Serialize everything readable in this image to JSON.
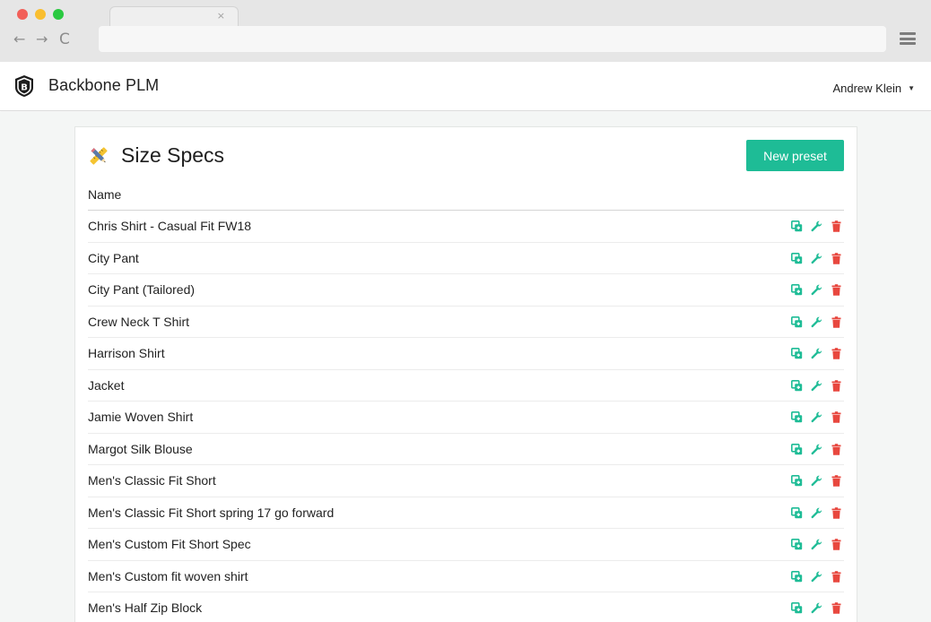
{
  "browser": {
    "tab_close": "×",
    "back_icon": "←",
    "forward_icon": "→",
    "reload_icon": "C",
    "url": ""
  },
  "app": {
    "logo_letter": "B",
    "brand": "Backbone PLM",
    "user": "Andrew Klein",
    "user_caret": "▼"
  },
  "card": {
    "title": "Size Specs",
    "new_button": "New preset",
    "column_header": "Name"
  },
  "rows": [
    "Chris Shirt - Casual Fit FW18",
    "City Pant",
    "City Pant (Tailored)",
    "Crew Neck T Shirt",
    "Harrison Shirt",
    "Jacket",
    "Jamie Woven Shirt",
    "Margot Silk Blouse",
    "Men's Classic Fit Short",
    "Men's Classic Fit Short spring 17 go forward",
    "Men's Custom Fit Short Spec",
    "Men's Custom fit woven shirt",
    "Men's Half Zip Block"
  ],
  "row_actions": [
    "duplicate-icon",
    "wrench-icon",
    "trash-icon"
  ],
  "colors": {
    "accent": "#1ebc96",
    "delete": "#e8473e"
  }
}
